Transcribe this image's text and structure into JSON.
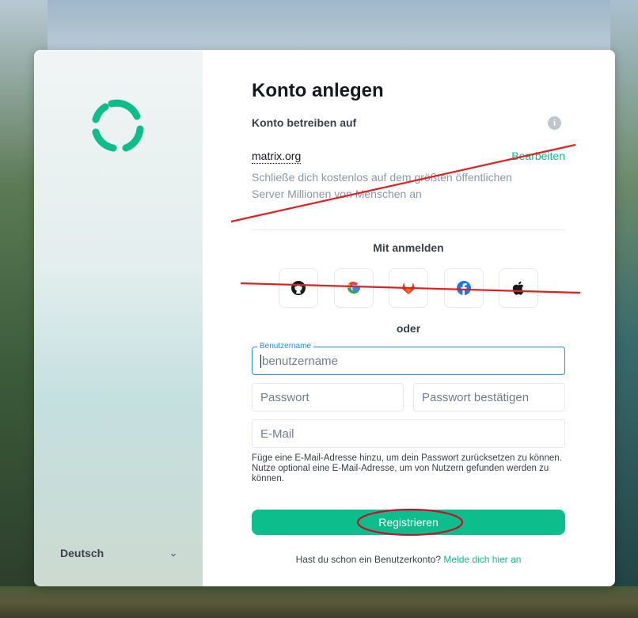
{
  "left_panel": {
    "logo": "element-logo-icon",
    "language": "Deutsch",
    "language_chevron": "chevron-down-icon"
  },
  "header": {
    "title": "Konto anlegen"
  },
  "homeserver": {
    "label": "Konto betreiben auf",
    "info_icon": "info-icon",
    "server": "matrix.org",
    "edit_label": "Bearbeiten",
    "description": "Schließe dich kostenlos auf dem größten öffentlichen Server Millionen von Menschen an"
  },
  "sso": {
    "heading": "Mit anmelden",
    "providers": [
      {
        "icon": "github-icon"
      },
      {
        "icon": "google-icon"
      },
      {
        "icon": "gitlab-icon"
      },
      {
        "icon": "facebook-icon"
      },
      {
        "icon": "apple-icon"
      }
    ]
  },
  "separator": "oder",
  "form": {
    "username_label": "Benutzername",
    "username_placeholder": "benutzername",
    "password_placeholder": "Passwort",
    "password_confirm_placeholder": "Passwort bestätigen",
    "email_placeholder": "E-Mail",
    "email_help": "Füge eine E-Mail-Adresse hinzu, um dein Passwort zurücksetzen zu können. Nutze optional eine E-Mail-Adresse, um von Nutzern gefunden werden zu können.",
    "submit_label": "Registrieren"
  },
  "footer": {
    "have_account": "Hast du schon ein Benutzerkonto?",
    "login_link": "Melde dich hier an"
  },
  "colors": {
    "accent": "#0dbd8b",
    "focus": "#238cf5",
    "annotation": "#e02020"
  }
}
